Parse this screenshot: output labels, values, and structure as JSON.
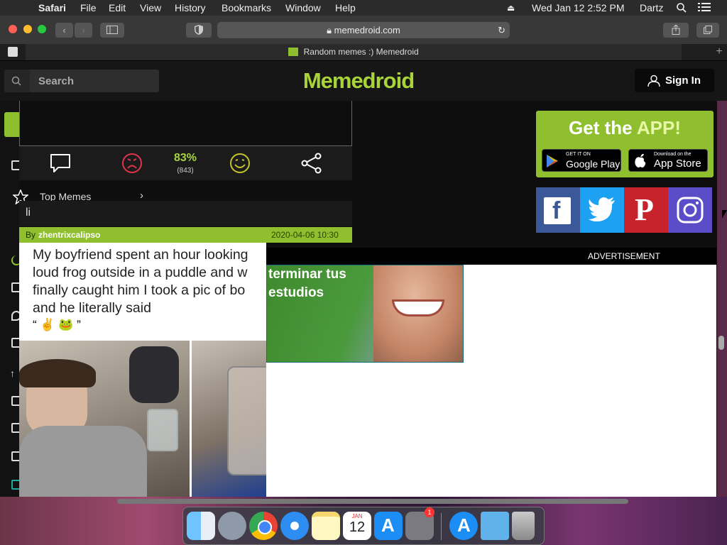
{
  "menubar": {
    "app": "Safari",
    "items": [
      "File",
      "Edit",
      "View",
      "History",
      "Bookmarks",
      "Window",
      "Help"
    ],
    "clock": "Wed Jan 12  2:52 PM",
    "user": "Dartz"
  },
  "browser": {
    "url": "memedroid.com",
    "tab_title": "Random memes :) Memedroid"
  },
  "site": {
    "search_placeholder": "Search",
    "logo": "Memedroid",
    "signin": "Sign In",
    "rating_percent": "83%",
    "rating_votes": "(843)",
    "top_memes": "Top Memes",
    "comment_input": "li",
    "author_prefix": "By",
    "author": "zhentrixcalipso",
    "post_date": "2020-04-06 10:30",
    "meme_text": "My boyfriend spent an hour looking\nloud frog outside in a puddle and w\nfinally caught him I took a pic of bo\nand he literally said",
    "meme_quote": "“ ✌️ 🐸 ”",
    "advertisement": "ADVERTISEMENT",
    "ad_text": "terminar tus\nestudios",
    "app_banner": {
      "title_get": "Get the",
      "title_app": "APP!",
      "google_small": "GET IT ON",
      "google_big": "Google Play",
      "apple_small": "Download on the",
      "apple_big": "App Store"
    },
    "social": [
      "facebook",
      "twitter",
      "pinterest",
      "instagram"
    ]
  },
  "dock": {
    "apps": [
      "finder",
      "launchpad",
      "chrome",
      "safari",
      "notes",
      "calendar",
      "app-store",
      "system-preferences",
      "app-store-2",
      "downloads-folder",
      "trash"
    ],
    "calendar_month": "JAN",
    "calendar_day": "12",
    "sysprefs_badge": "1"
  },
  "colors": {
    "accent_green": "#8fbf2f",
    "logo_green": "#a8d43a",
    "dislike_red": "#e0344a",
    "facebook": "#3b5998",
    "twitter": "#1da1f2",
    "pinterest": "#c8232c",
    "instagram": "#5b4cc7"
  }
}
